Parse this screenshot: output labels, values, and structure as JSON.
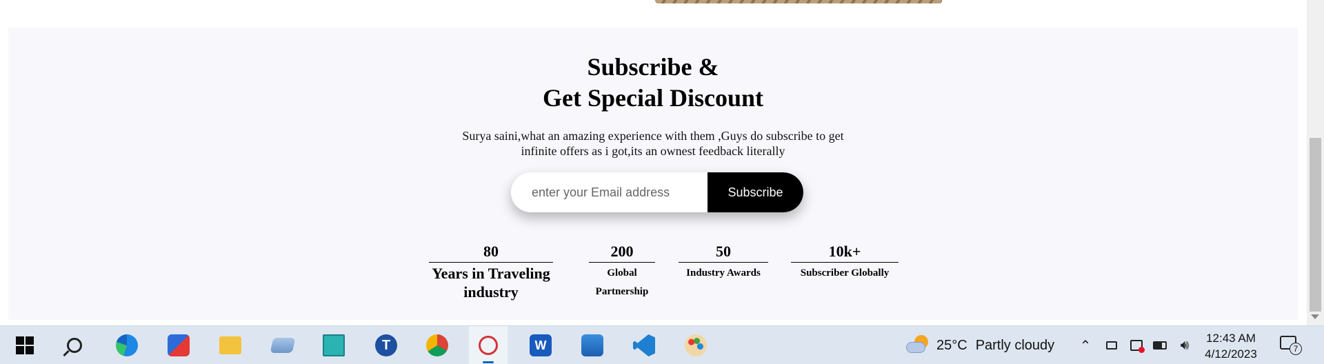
{
  "subscribe": {
    "title_line1": "Subscribe &",
    "title_line2": "Get Special Discount",
    "description_line1": "Surya saini,what an amazing experience with them ,Guys do subscribe to get",
    "description_line2": "infinite offers as i got,its an ownest feedback literally",
    "email_placeholder": "enter your Email address",
    "email_value": "",
    "button_label": "Subscribe"
  },
  "stats": [
    {
      "value": "80",
      "label_line1": "Years in Traveling",
      "label_line2": "industry"
    },
    {
      "value": "200",
      "label_line1": "Global",
      "label_line2": "Partnership"
    },
    {
      "value": "50",
      "label_line1": "Industry Awards",
      "label_line2": ""
    },
    {
      "value": "10k+",
      "label_line1": "Subscriber Globally",
      "label_line2": ""
    }
  ],
  "taskbar": {
    "apps": [
      "start-icon",
      "search-icon",
      "edge-icon",
      "microsoft-store-icon",
      "file-explorer-icon",
      "this-pc-icon",
      "fingerprint-app-icon",
      "t-app-icon",
      "chrome-icon",
      "snipping-tool-icon",
      "word-icon",
      "photos-icon",
      "vscode-icon",
      "paint-icon"
    ],
    "active_app": "snipping-tool-icon",
    "weather": {
      "temperature": "25°C",
      "condition": "Partly cloudy"
    },
    "clock": {
      "time": "12:43 AM",
      "date": "4/12/2023"
    },
    "notification_count": "7"
  },
  "colors": {
    "section_bg": "#f8f8fc",
    "button_bg": "#000000",
    "taskbar_bg": "#dde6f0",
    "accent": "#0067c0"
  }
}
